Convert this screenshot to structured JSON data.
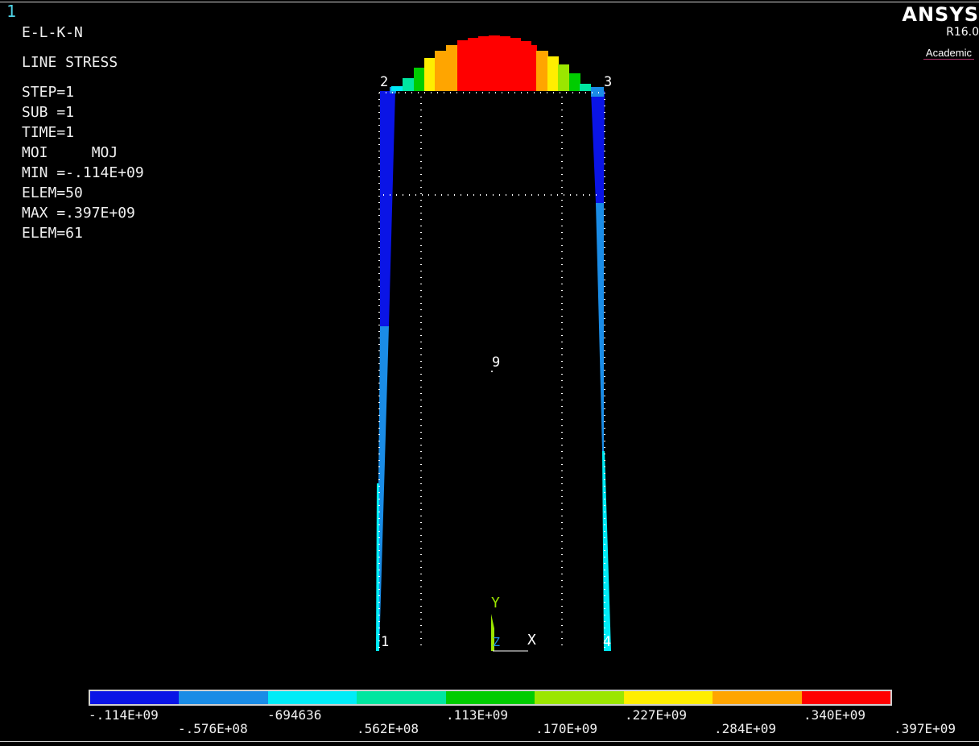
{
  "window_number": "1",
  "info": {
    "mode": "E-L-K-N",
    "title": "LINE STRESS",
    "step": "STEP=1",
    "sub": "SUB =1",
    "time": "TIME=1",
    "moi_moj": "MOI     MOJ",
    "min": "MIN =-.114E+09",
    "min_elem": "ELEM=50",
    "max": "MAX =.397E+09",
    "max_elem": "ELEM=61"
  },
  "brand": {
    "name": "ANSYS",
    "version": "R16.0",
    "edition": "Academic"
  },
  "keypoints": [
    "1",
    "2",
    "3",
    "4",
    "9"
  ],
  "triad": {
    "y": "Y",
    "z": "Z",
    "x": "X"
  },
  "legend": {
    "colors": [
      "#0a14e6",
      "#1a8ce6",
      "#00ecf7",
      "#00e6a0",
      "#00cc00",
      "#9be600",
      "#ffee00",
      "#ffa500",
      "#ff0000"
    ],
    "labels_top": [
      ".114E+09",
      "-694636",
      ".113E+09",
      ".227E+09",
      ".340E+09"
    ],
    "labels_bottom": [
      "-.576E+08",
      ".562E+08",
      ".170E+09",
      ".284E+09",
      ".397E+09"
    ],
    "label_first_prefix": "-"
  }
}
